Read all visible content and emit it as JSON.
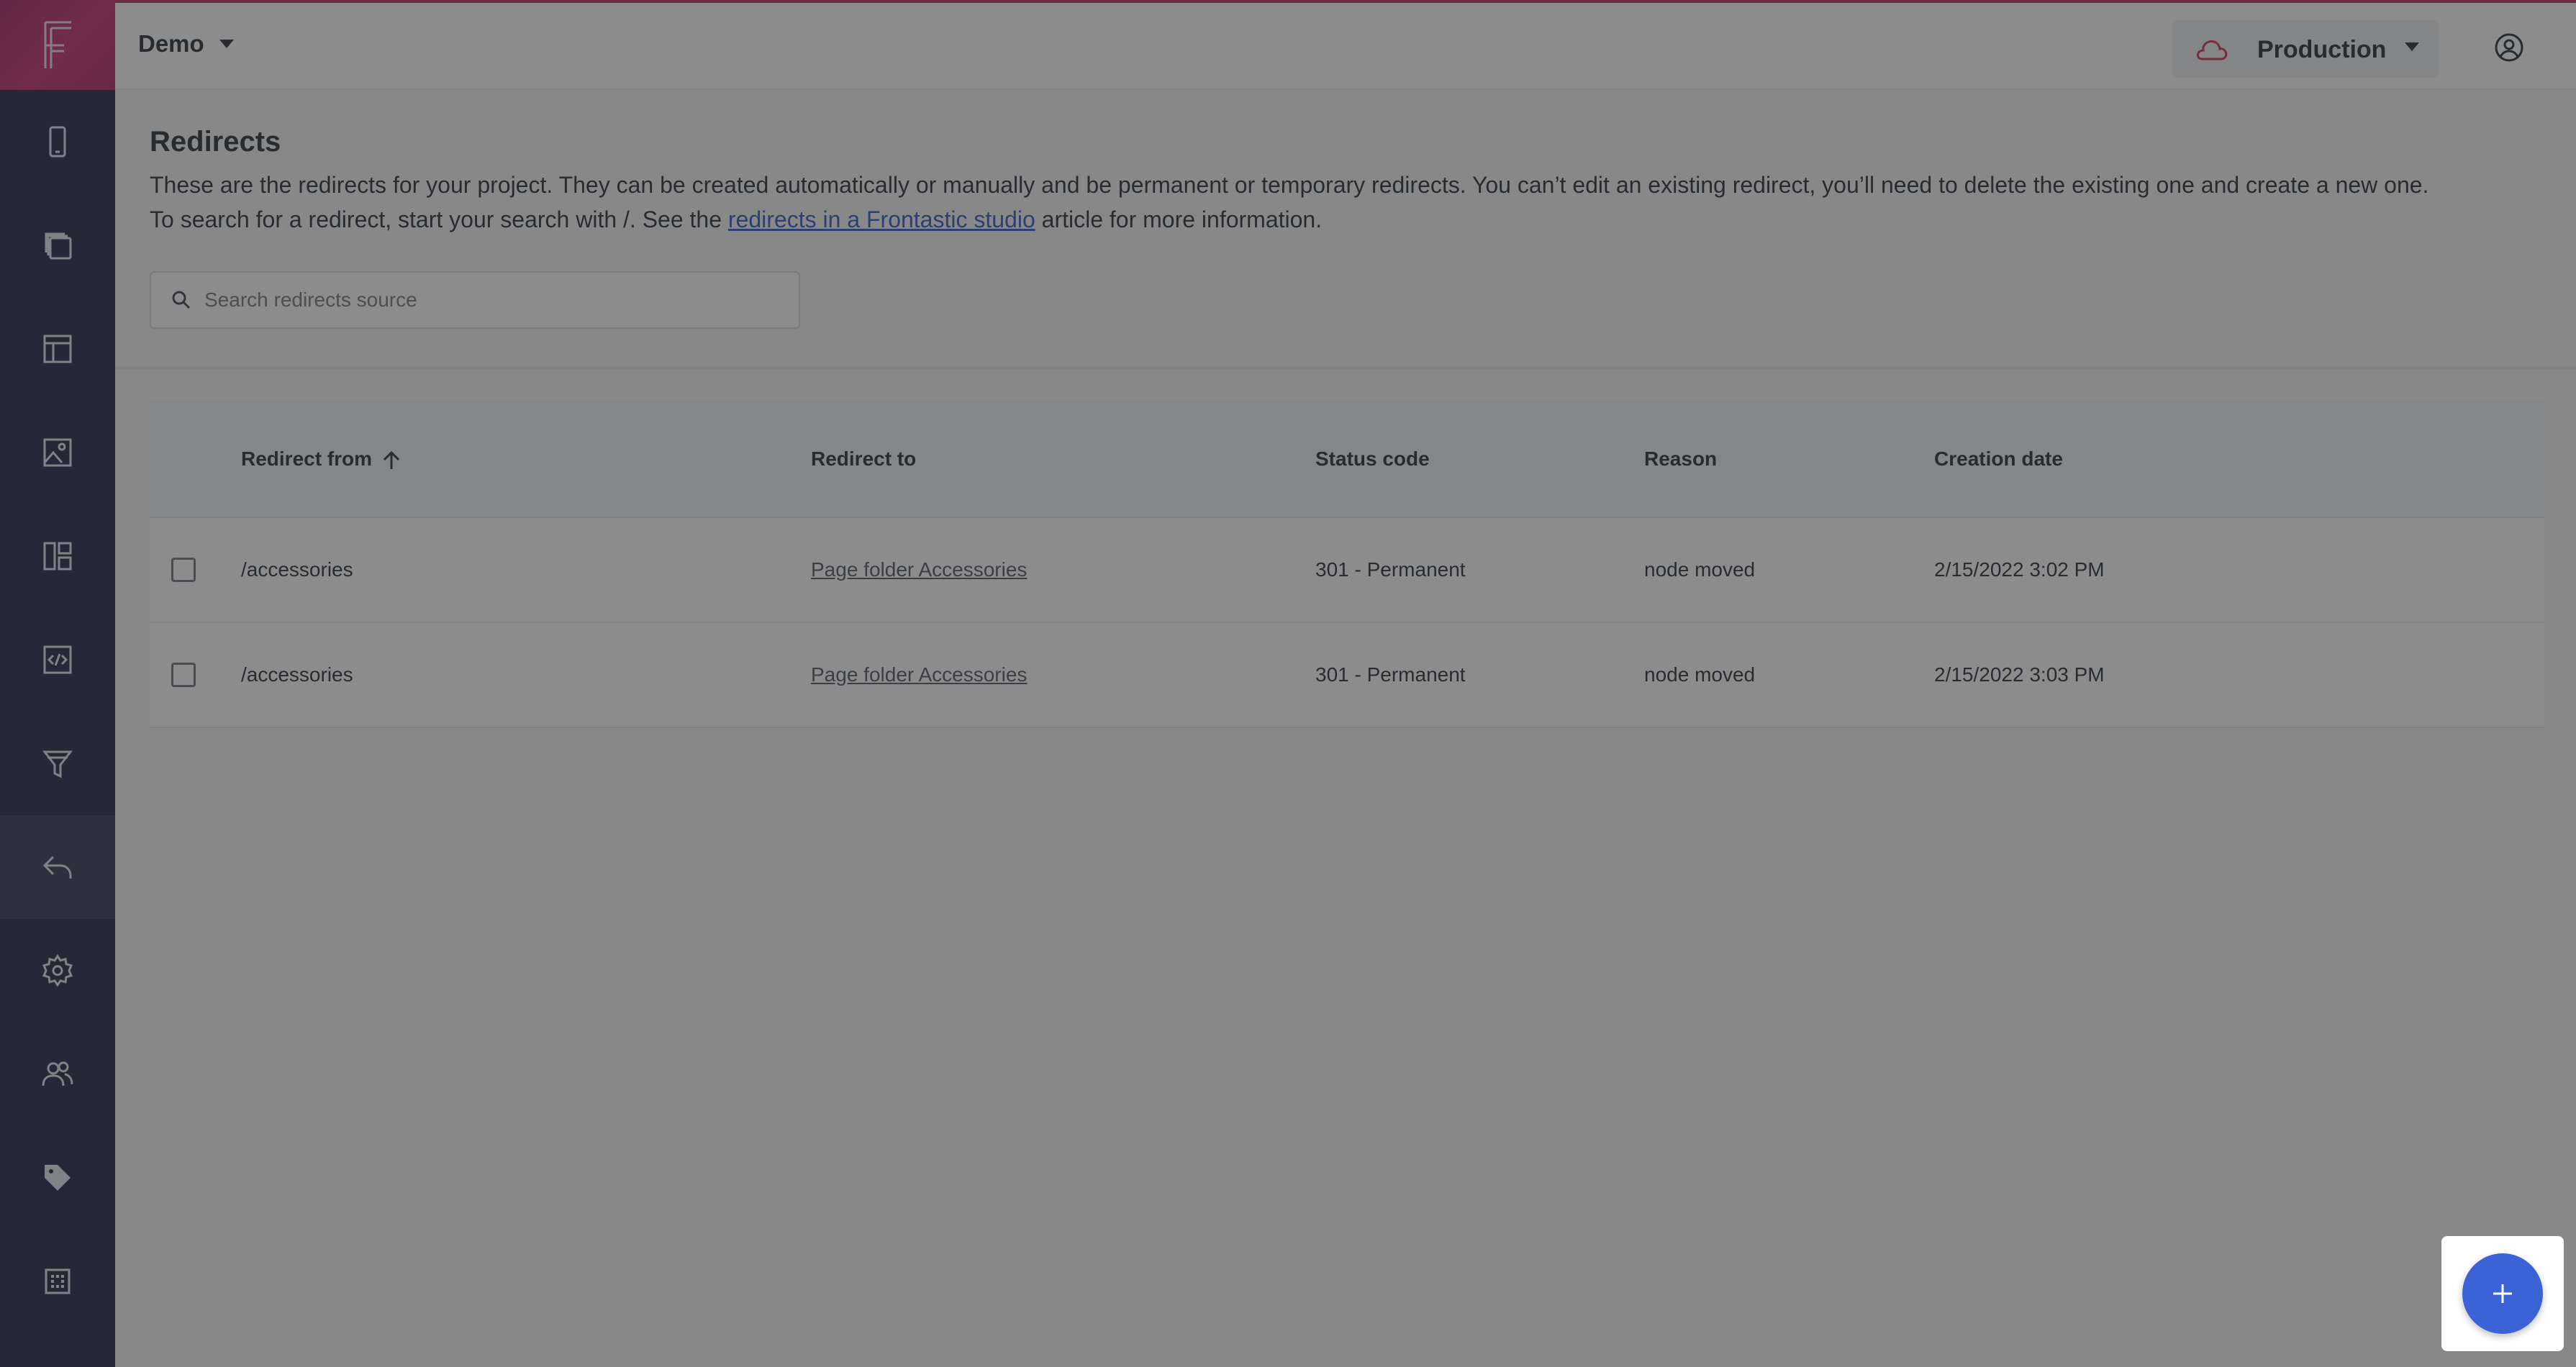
{
  "header": {
    "project_name": "Demo",
    "environment": "Production"
  },
  "page": {
    "title": "Redirects",
    "description_line1": "These are the redirects for your project. They can be created automatically or manually and be permanent or temporary redirects. You can’t edit an existing redirect, you’ll need to delete the existing one and create a new one.",
    "description_line2_prefix": "To search for a redirect, start your search with /. See the",
    "description_link": "redirects in a Frontastic studio",
    "description_line2_suffix": "article for more information."
  },
  "search": {
    "placeholder": "Search redirects source",
    "value": ""
  },
  "table": {
    "columns": {
      "redirect_from": "Redirect from",
      "redirect_to": "Redirect to",
      "status_code": "Status code",
      "reason": "Reason",
      "creation_date": "Creation date"
    },
    "rows": [
      {
        "from": "/accessories",
        "to": "Page folder Accessories",
        "status": "301 - Permanent",
        "reason": "node moved",
        "date": "2/15/2022 3:02 PM"
      },
      {
        "from": "/accessories",
        "to": "Page folder Accessories",
        "status": "301 - Permanent",
        "reason": "node moved",
        "date": "2/15/2022 3:03 PM"
      }
    ]
  },
  "sidebar": {
    "items": [
      {
        "icon": "mobile-icon"
      },
      {
        "icon": "copy-pages-icon"
      },
      {
        "icon": "layout-icon"
      },
      {
        "icon": "image-icon"
      },
      {
        "icon": "dashboard-icon"
      },
      {
        "icon": "code-icon"
      },
      {
        "icon": "filter-icon"
      },
      {
        "icon": "redirect-icon",
        "active": true
      },
      {
        "icon": "gear-icon"
      },
      {
        "icon": "users-icon"
      },
      {
        "icon": "tag-icon"
      },
      {
        "icon": "grid-icon"
      }
    ]
  },
  "colors": {
    "sidebar": "#1b2544",
    "brand": "#b9265d",
    "accent": "#3b63d6",
    "overlay": "rgba(45,45,45,0.55)"
  }
}
